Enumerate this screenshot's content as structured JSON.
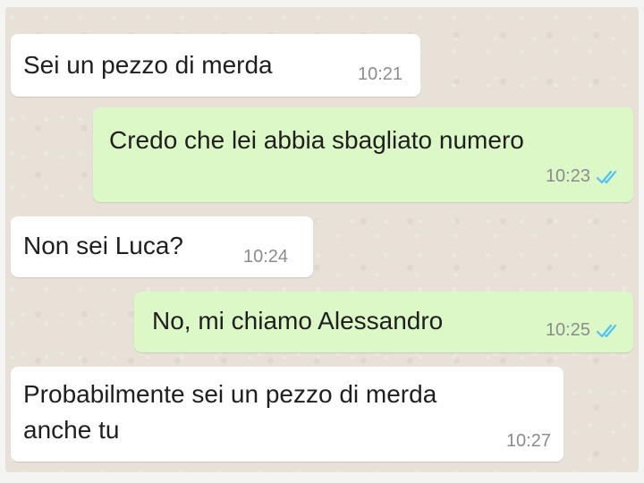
{
  "messages": [
    {
      "direction": "incoming",
      "text": "Sei un pezzo di merda",
      "time": "10:21"
    },
    {
      "direction": "outgoing",
      "text": "Credo che lei abbia sbagliato numero",
      "time": "10:23",
      "status": "read"
    },
    {
      "direction": "incoming",
      "text": "Non sei Luca?",
      "time": "10:24"
    },
    {
      "direction": "outgoing",
      "text": "No, mi chiamo Alessandro",
      "time": "10:25",
      "status": "read"
    },
    {
      "direction": "incoming",
      "text_line1": "Probabilmente sei un pezzo di merda",
      "text_line2": "anche tu",
      "time": "10:27"
    }
  ],
  "colors": {
    "incoming_bubble": "#ffffff",
    "outgoing_bubble": "#dcf8c6",
    "read_ticks": "#4fc3f7",
    "timestamp": "#8c8c8c"
  },
  "icons": {
    "read_status": "double-check-icon"
  }
}
